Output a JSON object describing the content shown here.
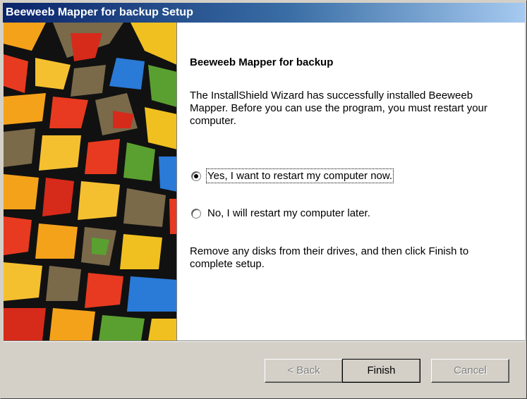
{
  "window": {
    "title": "Beeweeb Mapper for backup Setup"
  },
  "wizard": {
    "heading": "Beeweeb Mapper for backup",
    "message": "The InstallShield Wizard has successfully installed Beeweeb Mapper.  Before you can use the program, you must restart your computer.",
    "options": [
      {
        "label": "Yes, I want to restart my computer now.",
        "selected": true
      },
      {
        "label": "No, I will restart my computer later.",
        "selected": false
      }
    ],
    "instructions": "Remove any disks from their drives, and then click Finish to complete setup."
  },
  "buttons": {
    "back_label": "< Back",
    "finish_label": "Finish",
    "cancel_label": "Cancel"
  },
  "colors": {
    "titlebar_start": "#0a246a",
    "titlebar_end": "#a6caf0",
    "dialog_face": "#d4d0c8"
  }
}
